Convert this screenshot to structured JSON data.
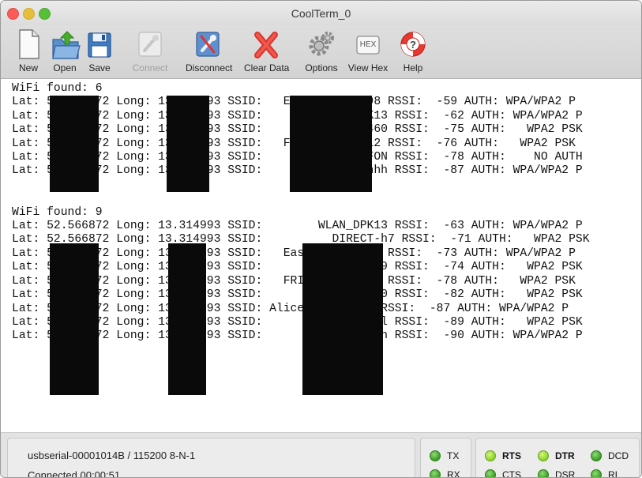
{
  "window": {
    "title": "CoolTerm_0"
  },
  "toolbar": {
    "new": "New",
    "open": "Open",
    "save": "Save",
    "connect": "Connect",
    "disconnect": "Disconnect",
    "clear_data": "Clear Data",
    "options": "Options",
    "view_hex": "View Hex",
    "help": "Help",
    "hex_icon_text": "HEX"
  },
  "terminal": {
    "lines": [
      "WiFi found: 6",
      "Lat: 52.566872 Long: 13.314993 SSID:   EasyBox-552498 RSSI:  -59 AUTH: WPA/WPA2 P",
      "Lat: 52.566872 Long: 13.314993 SSID:        WLAN_DPK13 RSSI:  -62 AUTH: WPA/WPA2 P",
      "Lat: 52.566872 Long: 13.314993 SSID:       WLAN-E6E460 RSSI:  -75 AUTH:   WPA2 PSK",
      "Lat: 52.566872 Long: 13.314993 SSID:   FRITZ!Box 7412 RSSI:  -76 AUTH:   WPA2 PSK",
      "Lat: 52.566872 Long: 13.314993 SSID:       Telekom_FON RSSI:  -78 AUTH:    NO AUTH",
      "Lat: 52.566872 Long: 13.314993 SSID:        Uhhhhhhhhh RSSI:  -87 AUTH: WPA/WPA2 P",
      "",
      "",
      "WiFi found: 9",
      "Lat: 52.566872 Long: 13.314993 SSID:        WLAN_DPK13 RSSI:  -63 AUTH: WPA/WPA2 P",
      "Lat: 52.566872 Long: 13.314993 SSID:          DIRECT-h7 RSSI:  -71 AUTH:   WPA2 PSK",
      "Lat: 52.566872 Long: 13.314993 SSID:   EasyBox-552498 RSSI:  -73 AUTH: WPA/WPA2 P",
      "Lat: 52.566872 Long: 13.314993 SSID:       WLAN-770519 RSSI:  -74 AUTH:   WPA2 PSK",
      "Lat: 52.566872 Long: 13.314993 SSID:   FRITZ!Box 7412 RSSI:  -78 AUTH:   WPA2 PSK",
      "Lat: 52.566872 Long: 13.314993 SSID:       WLAN-E6E460 RSSI:  -82 AUTH:   WPA2 PSK",
      "Lat: 52.566872 Long: 13.314993 SSID: Alice_im_wlan4_ RSSI:  -87 AUTH: WPA/WPA2 P",
      "Lat: 52.566872 Long: 13.314993 SSID:          Albarall RSSI:  -89 AUTH:   WPA2 PSK",
      "Lat: 52.566872 Long: 13.314993 SSID:        Uhhhhhhhhh RSSI:  -90 AUTH: WPA/WPA2 P"
    ]
  },
  "status": {
    "port": "usbserial-00001014B / 115200 8-N-1",
    "connection": "Connected 00:00:51",
    "tx": "TX",
    "rx": "RX",
    "rts": "RTS",
    "cts": "CTS",
    "dtr": "DTR",
    "dsr": "DSR",
    "dcd": "DCD",
    "ri": "RI"
  },
  "colors": {
    "led_on": "#3a9a24",
    "led_active": "#88d12b",
    "close": "#fc5b57",
    "minimize": "#e5bf3c",
    "maximize": "#57c038"
  }
}
